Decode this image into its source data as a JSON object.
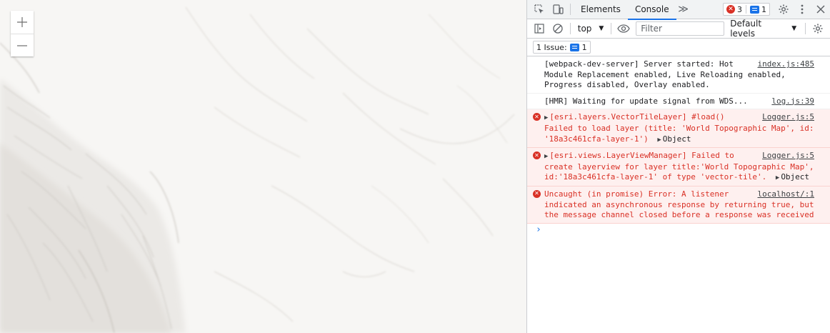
{
  "map": {
    "zoom_in_label": "+",
    "zoom_out_label": "−"
  },
  "devtools": {
    "tabs": [
      {
        "label": "Elements",
        "active": false
      },
      {
        "label": "Console",
        "active": true
      }
    ],
    "more_tabs_glyph": "≫",
    "error_count": "3",
    "message_count": "1",
    "toolbar": {
      "context": "top",
      "filter_placeholder": "Filter",
      "levels_label": "Default levels"
    },
    "issues": {
      "label": "1 Issue:",
      "count": "1"
    },
    "messages": [
      {
        "level": "info",
        "source": "index.js:485",
        "text": "[webpack-dev-server] Server started: Hot Module Replacement enabled, Live Reloading enabled, Progress disabled, Overlay enabled."
      },
      {
        "level": "info",
        "source": "log.js:39",
        "text": "[HMR] Waiting for update signal from WDS..."
      },
      {
        "level": "error",
        "source": "Logger.js:5",
        "expandable": true,
        "text": "[esri.layers.VectorTileLayer] #load() Failed to load layer (title: 'World Topographic Map', id: '18a3c461cfa-layer-1')",
        "object": "Object"
      },
      {
        "level": "error",
        "source": "Logger.js:5",
        "expandable": true,
        "text": "[esri.views.LayerViewManager] Failed to create layerview for layer title:'World Topographic Map', id:'18a3c461cfa-layer-1' of type 'vector-tile'.",
        "object": "Object"
      },
      {
        "level": "error",
        "source": "localhost/:1",
        "expandable": false,
        "text": "Uncaught (in promise) Error: A listener indicated an asynchronous response by returning true, but the message channel closed before a response was received",
        "object": ""
      }
    ],
    "prompt_glyph": "›"
  },
  "colors": {
    "error": "#d93025",
    "error_bg": "#fef0ef",
    "accent": "#1a73e8",
    "map_bg": "#f7f6f4"
  }
}
